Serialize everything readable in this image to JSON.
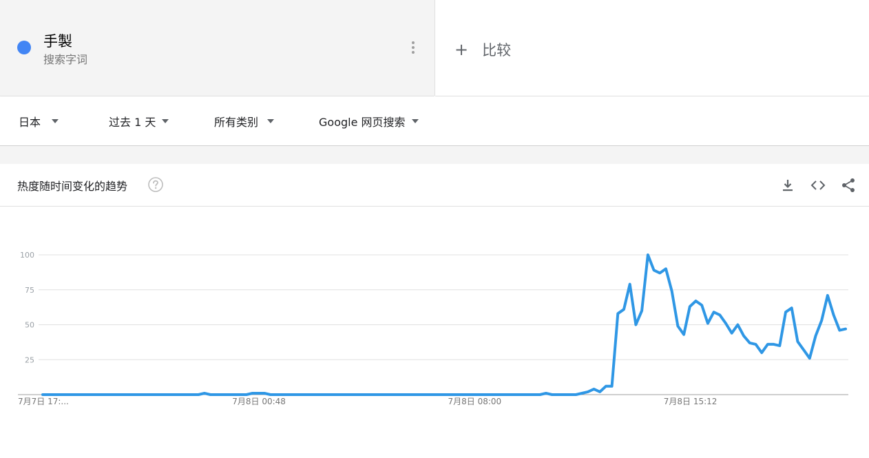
{
  "term": {
    "name": "手製",
    "type": "搜索字词",
    "dot_color": "#4285f4"
  },
  "compare": {
    "plus": "+",
    "label": "比较"
  },
  "filters": {
    "region": "日本",
    "time": "过去 1 天",
    "category": "所有类别",
    "property": "Google 网页搜索"
  },
  "card": {
    "title": "热度随时间变化的趋势",
    "icons": [
      "help-icon",
      "download-icon",
      "embed-icon",
      "share-icon"
    ]
  },
  "chart_data": {
    "type": "line",
    "color": "#2f97e5",
    "ylim": [
      0,
      100
    ],
    "yticks": [
      25,
      50,
      75,
      100
    ],
    "ytick_labels": [
      "25",
      "50",
      "75",
      "100"
    ],
    "xtick_labels": [
      "7月7日 17:...",
      "7月8日 00:48",
      "7月8日 08:00",
      "7月8日 15:12"
    ],
    "xtick_index": [
      0,
      36,
      72,
      108
    ],
    "series": [
      {
        "values": [
          0,
          0,
          0,
          0,
          0,
          0,
          0,
          0,
          0,
          0,
          0,
          0,
          0,
          0,
          0,
          0,
          0,
          0,
          0,
          0,
          0,
          0,
          0,
          0,
          0,
          0,
          0,
          1,
          0,
          0,
          0,
          0,
          0,
          0,
          0,
          1,
          1,
          1,
          0,
          0,
          0,
          0,
          0,
          0,
          0,
          0,
          0,
          0,
          0,
          0,
          0,
          0,
          0,
          0,
          0,
          0,
          0,
          0,
          0,
          0,
          0,
          0,
          0,
          0,
          0,
          0,
          0,
          0,
          0,
          0,
          0,
          0,
          0,
          0,
          0,
          0,
          0,
          0,
          0,
          0,
          0,
          0,
          0,
          0,
          1,
          0,
          0,
          0,
          0,
          0,
          1,
          2,
          4,
          2,
          6,
          6,
          58,
          61,
          79,
          50,
          60,
          100,
          89,
          87,
          90,
          74,
          49,
          43,
          63,
          67,
          64,
          51,
          59,
          57,
          51,
          44,
          50,
          42,
          37,
          36,
          30,
          36,
          36,
          35,
          59,
          62,
          38,
          32,
          26,
          42,
          53,
          71,
          57,
          46,
          47
        ]
      }
    ]
  }
}
